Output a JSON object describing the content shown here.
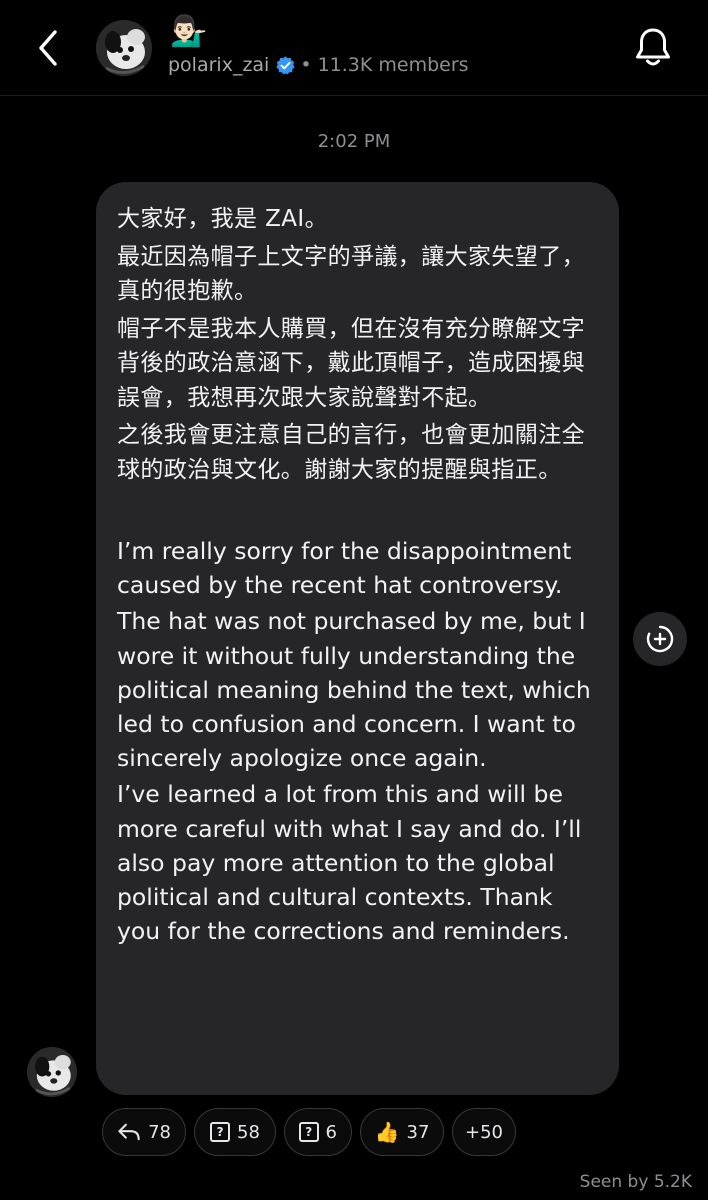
{
  "header": {
    "channel_emoji": "💁🏻‍♂️",
    "username": "polarix_zai",
    "members": "• 11.3K members"
  },
  "timestamp": "2:02 PM",
  "message": {
    "chinese_paragraphs": [
      "大家好，我是 ZAI。",
      "最近因為帽子上文字的爭議，讓大家失望了，真的很抱歉。",
      "帽子不是我本人購買，但在沒有充分瞭解文字背後的政治意涵下，戴此頂帽子，造成困擾與誤會，我想再次跟大家說聲對不起。",
      "之後我會更注意自己的言行，也會更加關注全球的政治與文化。謝謝大家的提醒與指正。"
    ],
    "english_paragraphs": [
      "I’m really sorry for the disappointment caused by the recent hat controversy.",
      "The hat was not purchased by me, but I wore it without fully understanding the political meaning behind the text, which led to confusion and concern. I want to sincerely apologize once again.",
      "I’ve learned a lot from this and will be more careful with what I say and do. I’ll also pay more attention to the global political and cultural contexts. Thank you for the corrections and reminders."
    ]
  },
  "reactions": [
    {
      "icon": "reply-arrow-icon",
      "count": "78"
    },
    {
      "icon": "question-box-icon",
      "glyph": "?",
      "count": "58"
    },
    {
      "icon": "question-box-icon",
      "glyph": "?",
      "count": "6"
    },
    {
      "emoji": "👍",
      "icon": "thumbs-up-icon",
      "count": "37"
    },
    {
      "label": "+50"
    }
  ],
  "seen_by": "Seen by 5.2K",
  "colors": {
    "background": "#000000",
    "bubble": "#262629",
    "verified": "#3797f0",
    "secondary_text": "#8e8e93"
  }
}
